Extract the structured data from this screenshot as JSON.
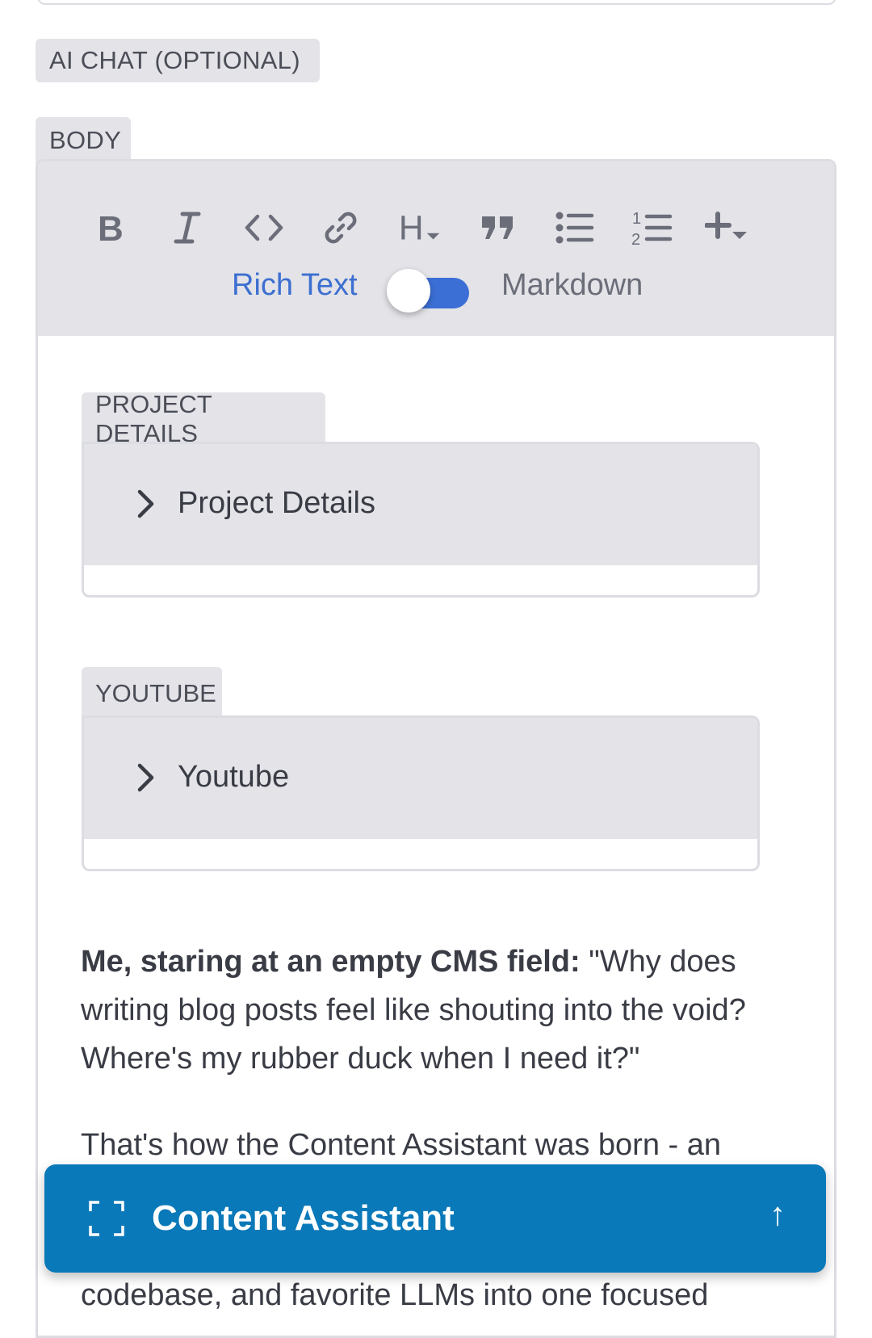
{
  "fields": {
    "ai_chat_label": "AI CHAT (OPTIONAL)",
    "body_label": "BODY"
  },
  "editor": {
    "toolbar": {
      "tools": [
        {
          "name": "bold",
          "glyph": "B"
        },
        {
          "name": "italic",
          "glyph": "I"
        },
        {
          "name": "code",
          "glyph": "<>"
        },
        {
          "name": "link",
          "glyph": "link-icon"
        },
        {
          "name": "heading",
          "glyph": "H"
        },
        {
          "name": "quote",
          "glyph": "quote-icon"
        },
        {
          "name": "bulleted-list",
          "glyph": "bullet-list-icon"
        },
        {
          "name": "numbered-list",
          "glyph": "numbered-list-icon"
        },
        {
          "name": "insert",
          "glyph": "plus-dropdown-icon"
        }
      ],
      "mode_rich_label": "Rich Text",
      "mode_markdown_label": "Markdown",
      "toggle_on_rich": true
    },
    "embeds": [
      {
        "tag": "PROJECT DETAILS",
        "title": "Project Details"
      },
      {
        "tag": "YOUTUBE",
        "title": "Youtube"
      }
    ],
    "paragraph1_bold": "Me, staring at an empty CMS field:",
    "paragraph1_rest": " \"Why does writing blog posts feel like shouting into the void? Where's my rubber duck when I need it?\"",
    "paragraph2_line1": "That's how the Content Assistant was born - an",
    "paragraph2_line_last": "codebase, and favorite LLMs into one focused"
  },
  "assistant": {
    "label": "Content Assistant",
    "arrow": "↑",
    "icon": "expand-icon",
    "color": "#0a79b9"
  },
  "colors": {
    "accent_blue": "#3c6fd5",
    "chip_gray": "#e3e3e8"
  }
}
